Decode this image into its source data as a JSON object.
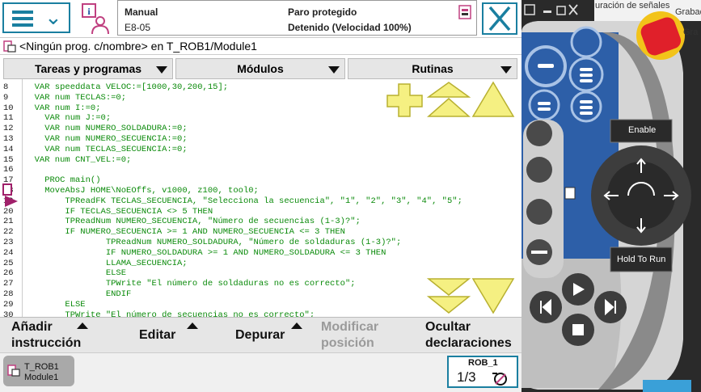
{
  "status": {
    "mode": "Manual",
    "controller": "E8-05",
    "state": "Paro protegido",
    "detail": "Detenido (Velocidad 100%)"
  },
  "program_title": "<Ningún prog. c/nombre> en T_ROB1/Module1",
  "tabs": [
    "Tareas y programas",
    "Módulos",
    "Rutinas"
  ],
  "code_lines": [
    {
      "no": "8",
      "text": "  VAR speeddata VELOC:=[1000,30,200,15];"
    },
    {
      "no": "9",
      "text": "  VAR num TECLAS:=0;"
    },
    {
      "no": "10",
      "text": "  VAR num I:=0;"
    },
    {
      "no": "11",
      "text": "    VAR num J:=0;"
    },
    {
      "no": "12",
      "text": "    VAR num NUMERO_SOLDADURA:=0;"
    },
    {
      "no": "13",
      "text": "    VAR num NUMERO_SECUENCIA:=0;"
    },
    {
      "no": "14",
      "text": "    VAR num TECLAS_SECUENCIA:=0;"
    },
    {
      "no": "15",
      "text": "  VAR num CNT_VEL:=0;"
    },
    {
      "no": "16",
      "text": ""
    },
    {
      "no": "17",
      "text": "    PROC main()"
    },
    {
      "no": "18",
      "text": "    MoveAbsJ HOME\\NoEOffs, v1000, z100, tool0;"
    },
    {
      "no": "19",
      "text": "        TPReadFK TECLAS_SECUENCIA, \"Selecciona la secuencia\", \"1\", \"2\", \"3\", \"4\", \"5\";"
    },
    {
      "no": "20",
      "text": "        IF TECLAS_SECUENCIA <> 5 THEN"
    },
    {
      "no": "21",
      "text": "        TPReadNum NUMERO_SECUENCIA, \"Número de secuencias (1-3)?\";"
    },
    {
      "no": "22",
      "text": "        IF NUMERO_SECUENCIA >= 1 AND NUMERO_SECUENCIA <= 3 THEN"
    },
    {
      "no": "23",
      "text": "                TPReadNum NUMERO_SOLDADURA, \"Número de soldaduras (1-3)?\";"
    },
    {
      "no": "24",
      "text": "                IF NUMERO_SOLDADURA >= 1 AND NUMERO_SOLDADURA <= 3 THEN"
    },
    {
      "no": "25",
      "text": "                LLAMA_SECUENCIA;"
    },
    {
      "no": "26",
      "text": "                ELSE"
    },
    {
      "no": "27",
      "text": "                TPWrite \"El número de soldaduras no es correcto\";"
    },
    {
      "no": "28",
      "text": "                ENDIF"
    },
    {
      "no": "29",
      "text": "        ELSE"
    },
    {
      "no": "30",
      "text": "        TPWrite \"El número de secuencias no es correcto\";"
    }
  ],
  "bottom_buttons": {
    "add_instruction": [
      "Añadir",
      "instrucción"
    ],
    "edit": "Editar",
    "debug": "Depurar",
    "modify_position": [
      "Modificar",
      "posición"
    ],
    "hide_declarations": [
      "Ocultar",
      "declaraciones"
    ]
  },
  "task": {
    "line1": "T_ROB1",
    "line2": "Module1"
  },
  "robot": {
    "name": "ROB_1",
    "speed_fraction": "1/3"
  },
  "flexpendant": {
    "enable_label": "Enable",
    "hold_to_run_label": "Hold To Run"
  },
  "background_fragments": {
    "settings": "uración de señales",
    "record": "Grabad",
    "record2": "Gra"
  },
  "colors": {
    "accent": "#1a7fa0",
    "code_green": "#0a8a0a",
    "arrow_yellow": "#f5f082",
    "pendant_blue": "#2d5fa8",
    "estop_red": "#e0202a",
    "estop_yellow": "#f2c31a"
  }
}
